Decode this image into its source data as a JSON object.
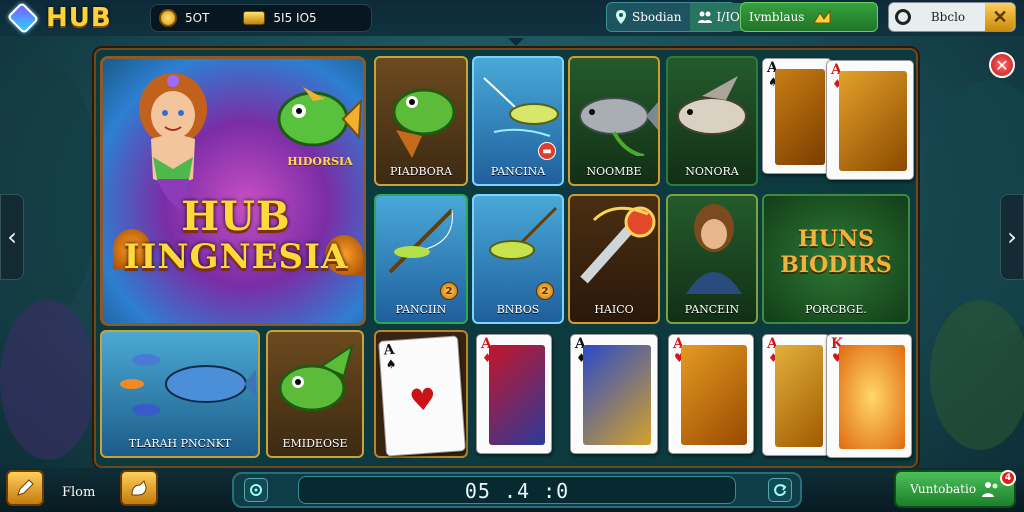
{
  "header": {
    "logo_text": "HUB",
    "wallet_coins": "5OT",
    "wallet_gold": "5I5 IO5",
    "pill1_left": "Sbodian",
    "pill1_right": "I/IO",
    "pill2": "Ivmblaus",
    "pill3": "Bbclo"
  },
  "hero": {
    "subtitle": "HIDORSIA",
    "title_line1": "HUB",
    "title_line2": "IINGNESIA"
  },
  "tiles": [
    {
      "label": "PIADBORA"
    },
    {
      "label": "PANCINA"
    },
    {
      "label": "NOOMBE"
    },
    {
      "label": "NONORA"
    },
    {
      "label": "PANCIIN",
      "num": "2"
    },
    {
      "label": "BNBOS",
      "num": "2"
    },
    {
      "label": "HAICO"
    },
    {
      "label": "PANCEIN"
    },
    {
      "label": "PORCBGE."
    },
    {
      "label": "TLARAH PNCNKT"
    },
    {
      "label": "EMIDEOSE"
    }
  ],
  "tile_feature": {
    "line1": "HUNS",
    "line2": "BIODIRS"
  },
  "cards": [
    {
      "rank": "A",
      "suit": "♠"
    },
    {
      "rank": "A",
      "suit": "♦"
    },
    {
      "rank": "A",
      "suit": "♦"
    },
    {
      "rank": "A",
      "suit": "♥"
    },
    {
      "rank": "A",
      "suit": "♠"
    },
    {
      "rank": "A",
      "suit": "♦"
    },
    {
      "rank": "A",
      "suit": "♦"
    },
    {
      "rank": "A",
      "suit": "♦"
    },
    {
      "rank": "K",
      "suit": "♥"
    }
  ],
  "footer": {
    "from_label": "Flom",
    "timer": "05 .4 :0",
    "cta_label": "Vuntobatio",
    "cta_badge": "4"
  },
  "colors": {
    "accent_gold": "#ffd23a",
    "cta_green": "#2f9c3d",
    "close_red": "#e02121"
  }
}
